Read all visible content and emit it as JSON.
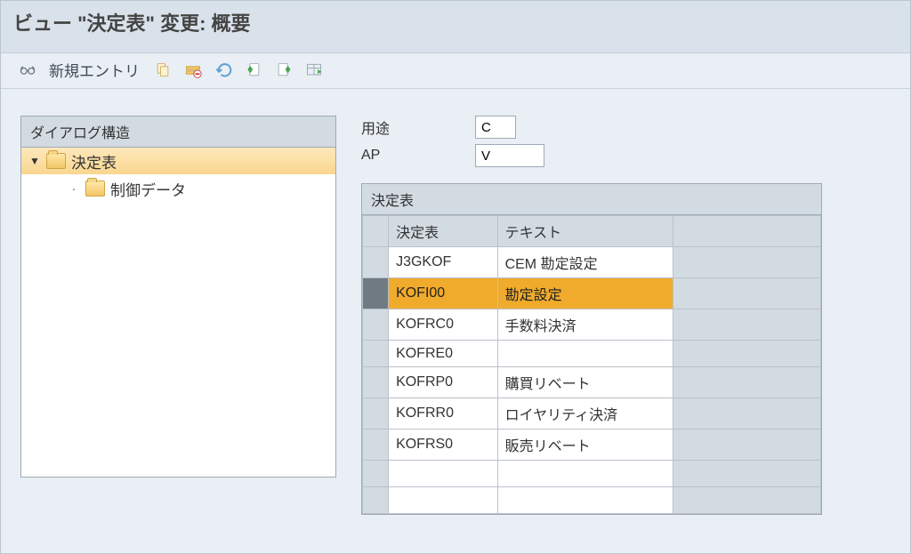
{
  "title": "ビュー \"決定表\" 変更: 概要",
  "toolbar": {
    "new_entry": "新規エントリ"
  },
  "tree": {
    "header": "ダイアログ構造",
    "root": {
      "label": "決定表"
    },
    "child": {
      "label": "制御データ"
    }
  },
  "form": {
    "usage_label": "用途",
    "usage_value": "C",
    "ap_label": "AP",
    "ap_value": "V"
  },
  "grid": {
    "title": "決定表",
    "col_code": "決定表",
    "col_text": "テキスト",
    "rows": [
      {
        "code": "J3GKOF",
        "text": "CEM 勘定設定",
        "selected": false
      },
      {
        "code": "KOFI00",
        "text": "勘定設定",
        "selected": true
      },
      {
        "code": "KOFRC0",
        "text": "手数料決済",
        "selected": false
      },
      {
        "code": "KOFRE0",
        "text": "",
        "selected": false
      },
      {
        "code": "KOFRP0",
        "text": "購買リベート",
        "selected": false
      },
      {
        "code": "KOFRR0",
        "text": "ロイヤリティ決済",
        "selected": false
      },
      {
        "code": "KOFRS0",
        "text": "販売リベート",
        "selected": false
      },
      {
        "code": "",
        "text": "",
        "selected": false
      },
      {
        "code": "",
        "text": "",
        "selected": false
      }
    ]
  }
}
